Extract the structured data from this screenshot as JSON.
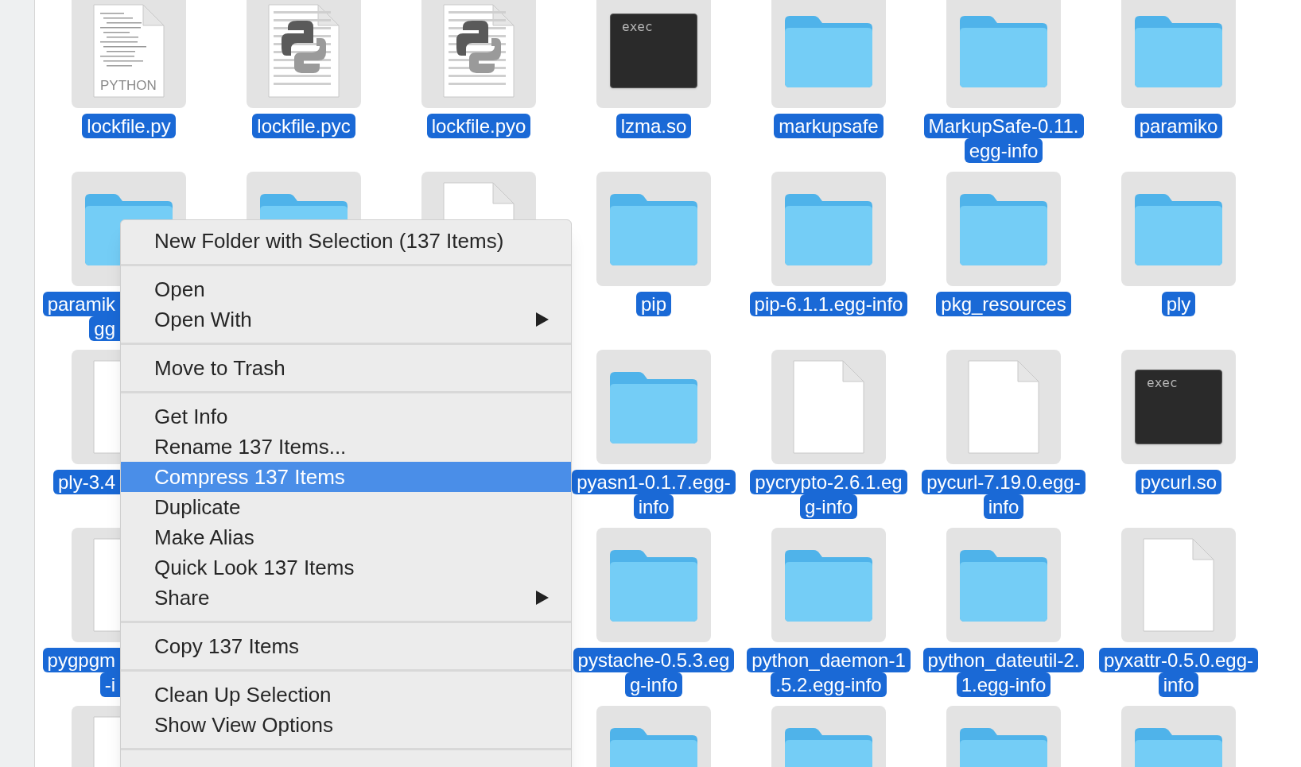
{
  "rows": [
    {
      "items": [
        {
          "kind": "source",
          "clipped": false,
          "icon_text": "PYTHON",
          "lines": [
            "lockfile.py"
          ],
          "selected": true
        },
        {
          "kind": "compiled",
          "clipped": false,
          "lines": [
            "lockfile.pyc"
          ],
          "selected": true
        },
        {
          "kind": "compiled",
          "clipped": false,
          "lines": [
            "lockfile.pyo"
          ],
          "selected": true
        },
        {
          "kind": "exec",
          "clipped": false,
          "icon_text": "exec",
          "lines": [
            "lzma.so"
          ],
          "selected": true
        },
        {
          "kind": "folder",
          "clipped": false,
          "lines": [
            "markupsafe"
          ],
          "selected": true
        },
        {
          "kind": "folder",
          "clipped": false,
          "lines": [
            "MarkupSafe-0.11.",
            "egg-info"
          ],
          "selected": true
        },
        {
          "kind": "folder",
          "clipped": false,
          "lines": [
            "paramiko"
          ],
          "selected": true
        }
      ]
    },
    {
      "items": [
        {
          "kind": "folder",
          "clipped": true,
          "lines": [
            "paramik",
            "gg"
          ],
          "selected": true
        },
        {
          "kind": "folder"
        },
        {
          "kind": "document"
        },
        {
          "kind": "folder",
          "clipped": false,
          "lines": [
            "pip"
          ],
          "selected": true
        },
        {
          "kind": "folder",
          "clipped": false,
          "lines": [
            "pip-6.1.1.egg-info"
          ],
          "selected": true
        },
        {
          "kind": "folder",
          "clipped": false,
          "lines": [
            "pkg_resources"
          ],
          "selected": true
        },
        {
          "kind": "folder",
          "clipped": false,
          "lines": [
            "ply"
          ],
          "selected": true
        }
      ]
    },
    {
      "items": [
        {
          "kind": "document",
          "clipped": true,
          "lines": [
            "ply-3.4"
          ],
          "selected": true
        },
        {
          "kind": "covered"
        },
        {
          "kind": "covered"
        },
        {
          "kind": "folder",
          "clipped": false,
          "lines": [
            "pyasn1-0.1.7.egg-",
            "info"
          ],
          "selected": true
        },
        {
          "kind": "document",
          "clipped": false,
          "lines": [
            "pycrypto-2.6.1.eg",
            "g-info"
          ],
          "selected": true
        },
        {
          "kind": "document",
          "clipped": false,
          "lines": [
            "pycurl-7.19.0.egg-",
            "info"
          ],
          "selected": true
        },
        {
          "kind": "exec",
          "clipped": false,
          "icon_text": "exec",
          "lines": [
            "pycurl.so"
          ],
          "selected": true
        }
      ]
    },
    {
      "items": [
        {
          "kind": "document",
          "clipped": true,
          "lines": [
            "pygpgm",
            "-i"
          ],
          "selected": true
        },
        {
          "kind": "covered"
        },
        {
          "kind": "covered"
        },
        {
          "kind": "folder",
          "clipped": false,
          "lines": [
            "pystache-0.5.3.eg",
            "g-info"
          ],
          "selected": true
        },
        {
          "kind": "folder",
          "clipped": false,
          "lines": [
            "python_daemon-1",
            ".5.2.egg-info"
          ],
          "selected": true
        },
        {
          "kind": "folder",
          "clipped": false,
          "lines": [
            "python_dateutil-2.",
            "1.egg-info"
          ],
          "selected": true
        },
        {
          "kind": "document",
          "clipped": false,
          "lines": [
            "pyxattr-0.5.0.egg-",
            "info"
          ],
          "selected": true
        }
      ]
    },
    {
      "items": [
        {
          "kind": "document"
        },
        {
          "kind": "covered"
        },
        {
          "kind": "covered"
        },
        {
          "kind": "folder"
        },
        {
          "kind": "folder"
        },
        {
          "kind": "folder"
        },
        {
          "kind": "folder"
        }
      ]
    }
  ],
  "context_menu": {
    "groups": [
      {
        "items": [
          {
            "label": "New Folder with Selection (137 Items)",
            "selected": false,
            "submenu": false
          }
        ]
      },
      {
        "items": [
          {
            "label": "Open",
            "selected": false,
            "submenu": false
          },
          {
            "label": "Open With",
            "selected": false,
            "submenu": true
          }
        ]
      },
      {
        "items": [
          {
            "label": "Move to Trash",
            "selected": false,
            "submenu": false
          }
        ]
      },
      {
        "items": [
          {
            "label": "Get Info",
            "selected": false,
            "submenu": false
          },
          {
            "label": "Rename 137 Items...",
            "selected": false,
            "submenu": false
          },
          {
            "label": "Compress 137 Items",
            "selected": true,
            "submenu": false
          },
          {
            "label": "Duplicate",
            "selected": false,
            "submenu": false
          },
          {
            "label": "Make Alias",
            "selected": false,
            "submenu": false
          },
          {
            "label": "Quick Look 137 Items",
            "selected": false,
            "submenu": false
          },
          {
            "label": "Share",
            "selected": false,
            "submenu": true
          }
        ]
      },
      {
        "items": [
          {
            "label": "Copy 137 Items",
            "selected": false,
            "submenu": false
          }
        ]
      },
      {
        "items": [
          {
            "label": "Clean Up Selection",
            "selected": false,
            "submenu": false
          },
          {
            "label": "Show View Options",
            "selected": false,
            "submenu": false
          }
        ]
      }
    ]
  }
}
